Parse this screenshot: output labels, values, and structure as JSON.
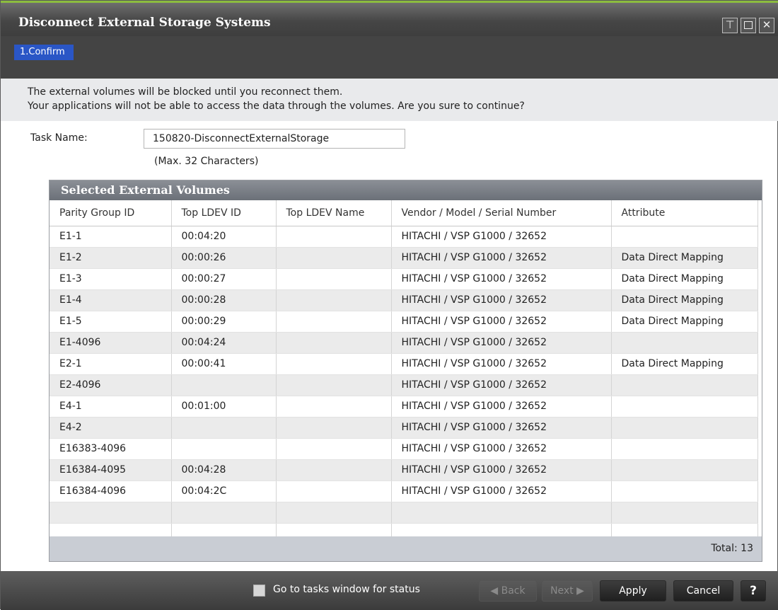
{
  "window": {
    "title": "Disconnect External Storage Systems"
  },
  "steps": {
    "active": "1.Confirm"
  },
  "message": {
    "line1": "The external volumes will be blocked until you reconnect them.",
    "line2": "Your applications will not be able to access the data through the volumes. Are you sure to continue?"
  },
  "task": {
    "label": "Task Name:",
    "value": "150820-DisconnectExternalStorage",
    "hint": "(Max. 32 Characters)"
  },
  "table": {
    "title": "Selected External Volumes",
    "columns": [
      "Parity Group ID",
      "Top LDEV ID",
      "Top LDEV Name",
      "Vendor / Model / Serial Number",
      "Attribute"
    ],
    "rows": [
      [
        "E1-1",
        "00:04:20",
        "",
        "HITACHI / VSP G1000 / 32652",
        ""
      ],
      [
        "E1-2",
        "00:00:26",
        "",
        "HITACHI / VSP G1000 / 32652",
        "Data Direct Mapping"
      ],
      [
        "E1-3",
        "00:00:27",
        "",
        "HITACHI / VSP G1000 / 32652",
        "Data Direct Mapping"
      ],
      [
        "E1-4",
        "00:00:28",
        "",
        "HITACHI / VSP G1000 / 32652",
        "Data Direct Mapping"
      ],
      [
        "E1-5",
        "00:00:29",
        "",
        "HITACHI / VSP G1000 / 32652",
        "Data Direct Mapping"
      ],
      [
        "E1-4096",
        "00:04:24",
        "",
        "HITACHI / VSP G1000 / 32652",
        ""
      ],
      [
        "E2-1",
        "00:00:41",
        "",
        "HITACHI / VSP G1000 / 32652",
        "Data Direct Mapping"
      ],
      [
        "E2-4096",
        "",
        "",
        "HITACHI / VSP G1000 / 32652",
        ""
      ],
      [
        "E4-1",
        "00:01:00",
        "",
        "HITACHI / VSP G1000 / 32652",
        ""
      ],
      [
        "E4-2",
        "",
        "",
        "HITACHI / VSP G1000 / 32652",
        ""
      ],
      [
        "E16383-4096",
        "",
        "",
        "HITACHI / VSP G1000 / 32652",
        ""
      ],
      [
        "E16384-4095",
        "00:04:28",
        "",
        "HITACHI / VSP G1000 / 32652",
        ""
      ],
      [
        "E16384-4096",
        "00:04:2C",
        "",
        "HITACHI / VSP G1000 / 32652",
        ""
      ],
      [
        "",
        "",
        "",
        "",
        ""
      ],
      [
        "",
        "",
        "",
        "",
        ""
      ]
    ],
    "total": "Total:  13"
  },
  "footer": {
    "goto_tasks_label": "Go to tasks window for status",
    "back_label": "Back",
    "next_label": "Next",
    "apply_label": "Apply",
    "cancel_label": "Cancel",
    "help_label": "?"
  }
}
